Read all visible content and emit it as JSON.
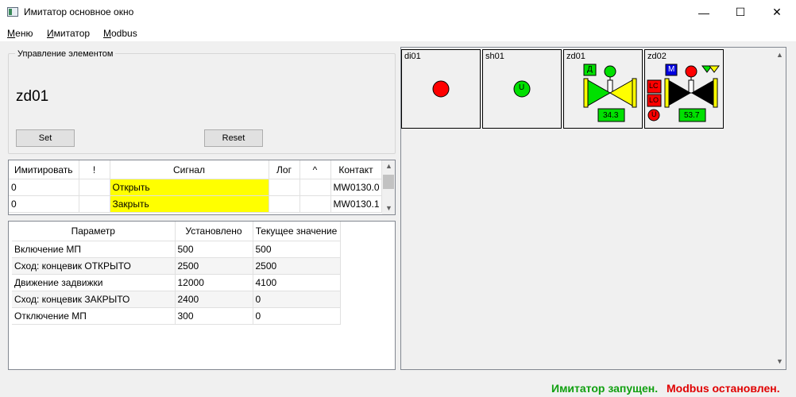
{
  "window": {
    "title": "Имитатор основное окно",
    "minimize": "—",
    "maximize": "☐",
    "close": "✕"
  },
  "menu": {
    "items": [
      {
        "u": "М",
        "rest": "еню"
      },
      {
        "u": "И",
        "rest": "митатор"
      },
      {
        "u": "M",
        "rest": "odbus"
      }
    ]
  },
  "control": {
    "group_title": "Управление элементом",
    "element_name": "zd01",
    "set_label": "Set",
    "reset_label": "Reset"
  },
  "signal_table": {
    "headers": [
      "Имитировать",
      "!",
      "Сигнал",
      "Лог",
      "^",
      "Контакт"
    ],
    "rows": [
      {
        "imit": "0",
        "excl": "",
        "signal": "Открыть",
        "log": "",
        "caret": "",
        "contact": "MW0130.0"
      },
      {
        "imit": "0",
        "excl": "",
        "signal": "Закрыть",
        "log": "",
        "caret": "",
        "contact": "MW0130.1"
      }
    ]
  },
  "param_table": {
    "headers": [
      "Параметр",
      "Установлено",
      "Текущее значение"
    ],
    "rows": [
      {
        "name": "Включение МП",
        "set": "500",
        "current": "500"
      },
      {
        "name": "Сход: концевик ОТКРЫТО",
        "set": "2500",
        "current": "2500"
      },
      {
        "name": "Движение задвижки",
        "set": "12000",
        "current": "4100"
      },
      {
        "name": "Сход: концевик ЗАКРЫТО",
        "set": "2400",
        "current": "0"
      },
      {
        "name": "Отключение МП",
        "set": "300",
        "current": "0"
      }
    ]
  },
  "tiles": [
    {
      "label": "di01"
    },
    {
      "label": "sh01",
      "lamp_text": "U"
    },
    {
      "label": "zd01",
      "mode": "Д",
      "value": "34.3"
    },
    {
      "label": "zd02",
      "mode": "M",
      "value": "53.7",
      "badge1": "LC",
      "badge2": "LO",
      "lamp_text": "U"
    }
  ],
  "status": {
    "running": "Имитатор запущен.",
    "modbus": "Modbus остановлен."
  },
  "colors": {
    "signal_highlight": "#ffff00",
    "status_ok": "#10a010",
    "status_err": "#e00000",
    "value_box": "#00e000"
  }
}
